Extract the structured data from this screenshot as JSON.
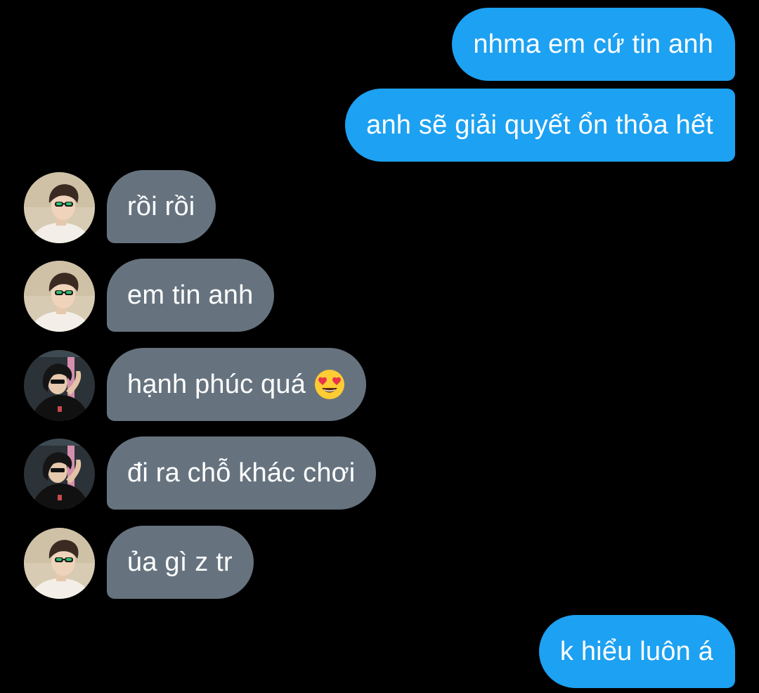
{
  "colors": {
    "background": "#000000",
    "outgoing_bubble": "#1DA1F2",
    "incoming_bubble": "#66737F",
    "text": "#FFFFFF"
  },
  "messages": [
    {
      "direction": "outgoing",
      "text": "nhma em cứ tin anh"
    },
    {
      "direction": "outgoing",
      "text": "anh sẽ giải quyết ổn thỏa hết"
    },
    {
      "direction": "incoming",
      "sender_avatar": "avatar-boy-sunglasses",
      "text": "rồi rồi"
    },
    {
      "direction": "incoming",
      "sender_avatar": "avatar-boy-sunglasses",
      "text": "em tin anh"
    },
    {
      "direction": "incoming",
      "sender_avatar": "avatar-person-black-tshirt",
      "text": "hạnh phúc quá",
      "emoji": "heart-eyes-emoji"
    },
    {
      "direction": "incoming",
      "sender_avatar": "avatar-person-black-tshirt",
      "text": "đi ra chỗ khác chơi"
    },
    {
      "direction": "incoming",
      "sender_avatar": "avatar-boy-sunglasses",
      "text": "ủa gì z tr"
    },
    {
      "direction": "outgoing",
      "text": "k hiểu luôn á"
    }
  ]
}
